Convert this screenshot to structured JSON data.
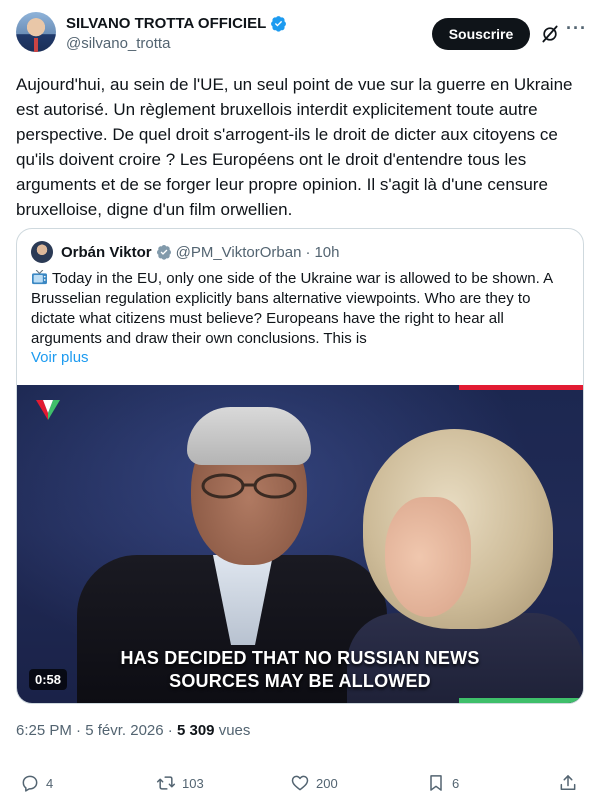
{
  "author": {
    "display_name": "SILVANO TROTTA OFFICIEL",
    "handle": "@silvano_trotta"
  },
  "header": {
    "subscribe_label": "Souscrire"
  },
  "tweet": {
    "text": "Aujourd'hui, au sein de l'UE, un seul point de vue sur la guerre en Ukraine est autorisé. Un règlement bruxellois interdit explicitement toute autre perspective. De quel droit s'arrogent-ils le droit de dicter aux citoyens ce qu'ils doivent croire ? Les Européens ont le droit d'entendre tous les arguments et de se forger leur propre opinion. Il s'agit là d'une censure bruxelloise, digne d'un film orwellien."
  },
  "quote": {
    "name": "Orbán Viktor",
    "handle": "@PM_ViktorOrban",
    "separator": "·",
    "time": "10h",
    "text": "Today in the EU, only one side of the Ukraine war is allowed to be shown. A Brusselian regulation explicitly bans alternative viewpoints. Who are they to dictate what citizens must believe? Europeans have the right to hear all arguments and draw their own conclusions. This is",
    "more_label": "Voir plus",
    "video": {
      "caption_line1": "HAS DECIDED THAT NO RUSSIAN NEWS",
      "caption_line2": "SOURCES MAY BE ALLOWED",
      "duration": "0:58"
    }
  },
  "meta": {
    "time": "6:25 PM",
    "separator": "·",
    "date": "5 févr. 2026",
    "separator2": "·",
    "views_count": "5 309",
    "views_label": "vues"
  },
  "actions": {
    "replies": "4",
    "reposts": "103",
    "likes": "200",
    "bookmarks": "6"
  },
  "colors": {
    "verified_blue": "#1d9bf0",
    "link_blue": "#1d9bf0",
    "secondary_text": "#536471",
    "primary_text": "#0f1419",
    "border": "#cfd9de",
    "video_red_bar": "#e21b32",
    "video_green_bar": "#3fbf6a"
  },
  "icons": {
    "verified": "verified-badge-icon",
    "grok": "grok-icon",
    "more": "more-icon",
    "tv": "tv-emoji-icon",
    "reply": "reply-icon",
    "repost": "repost-icon",
    "like": "like-icon",
    "bookmark": "bookmark-icon",
    "share": "share-icon"
  }
}
